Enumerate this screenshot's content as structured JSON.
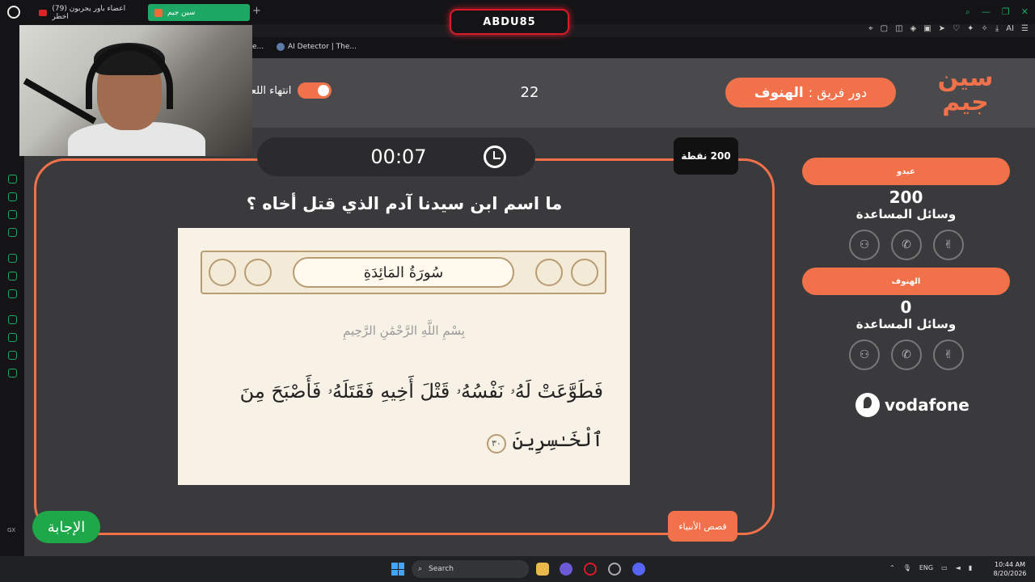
{
  "browser": {
    "tabs": [
      {
        "label": "(79) اعضاء باور يجربون اخطر"
      },
      {
        "label": "سين جيم"
      }
    ],
    "profile_name": "ABDU85",
    "bookmarks": [
      {
        "label": "AI Detector | The..."
      },
      {
        "label": "e..."
      }
    ],
    "extension_label": "AI",
    "sidebar_label": "GX"
  },
  "game": {
    "turn_prefix": "دور فريق :",
    "turn_team": "الهنوف",
    "round_number": "22",
    "end_game_label": "انتهاء اللعبة",
    "brand_logo": "سين جيم",
    "timer": "00:07",
    "points": "200 نقطة",
    "question": "ما اسم ابن سيدنا آدم الذي قتل أخاه ؟",
    "quran": {
      "surah_title": "سُورَةُ المَائِدَةِ",
      "basmala": "بِسْمِ اللَّهِ الرَّحْمَٰنِ الرَّحِيمِ",
      "verse_line1": "فَطَوَّعَتْ لَهُۥ نَفْسُهُۥ قَتْلَ أَخِيهِ فَقَتَلَهُۥ فَأَصْبَحَ مِنَ",
      "verse_line2": "ٱلْخَـٰسِرِينَ",
      "ayah_number": "٣٠"
    },
    "answer_label": "الإجابة",
    "category": "قصص الأنبياء"
  },
  "teams": [
    {
      "name": "عبدو",
      "score": "200",
      "aids_label": "وسائل المساعدة"
    },
    {
      "name": "الهنوف",
      "score": "0",
      "aids_label": "وسائل المساعدة"
    }
  ],
  "aids_icons": [
    "two-people-icon",
    "phone-icon",
    "peace-hand-icon"
  ],
  "sponsor": "vodafone",
  "taskbar": {
    "search_placeholder": "Search",
    "language": "ENG",
    "time": "10:44 AM",
    "date": "8/20/2026"
  },
  "colors": {
    "accent": "#f0714a",
    "answer_green": "#1ea84a",
    "tab_green": "#1ea866",
    "page_bg": "#3a3a3d"
  }
}
